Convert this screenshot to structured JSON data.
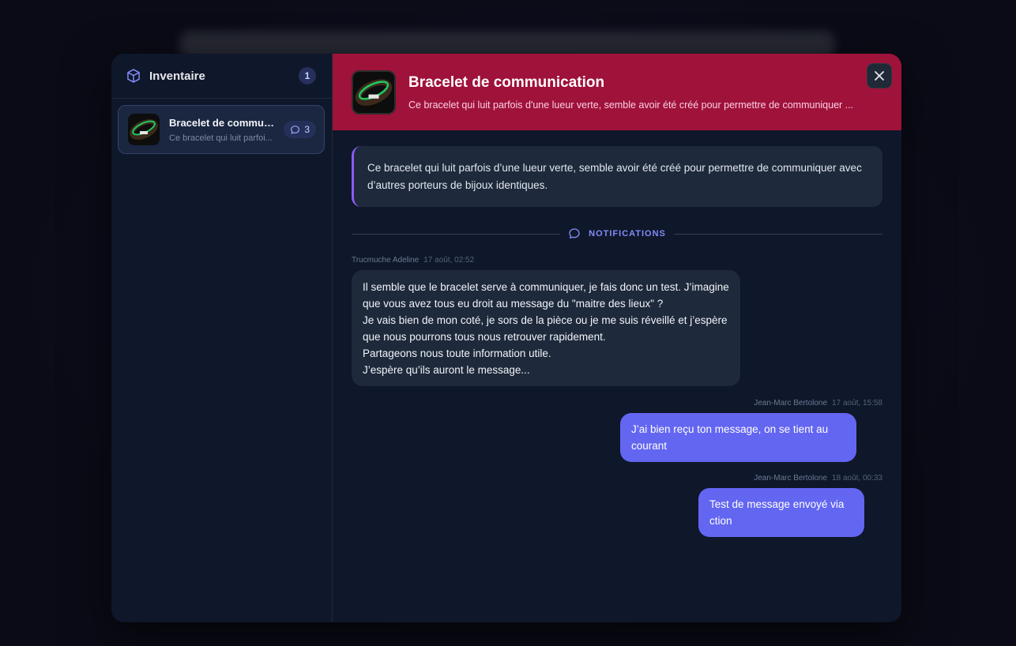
{
  "sidebar": {
    "title": "Inventaire",
    "count": "1",
    "items": [
      {
        "name": "Bracelet de commun...",
        "desc": "Ce bracelet qui luit parfoi...",
        "message_count": "3"
      }
    ]
  },
  "item": {
    "title": "Bracelet de communication",
    "subtitle": "Ce bracelet qui luit parfois d'une lueur verte, semble avoir été créé pour permettre de communiquer ...",
    "description": "Ce bracelet qui luit parfois d’une lueur verte, semble avoir été créé pour permettre de communiquer avec d’autres porteurs de bijoux identiques."
  },
  "notifications_label": "NOTIFICATIONS",
  "messages": [
    {
      "author": "Trucmuche Adeline",
      "time": "17 août, 02:52",
      "lines": [
        "Il semble que le bracelet serve à communiquer, je fais donc un test. J’imagine",
        "que vous avez tous eu droit au message du \"maitre des lieux\" ?",
        "Je vais bien de mon coté, je sors de la pièce ou je me suis réveillé et j’espère",
        "que nous pourrons tous nous retrouver rapidement.",
        "Partageons nous toute information utile.",
        "J’espère qu’ils auront le message..."
      ]
    },
    {
      "author": "Jean-Marc Bertolone",
      "time": "17 août, 15:58",
      "lines": [
        "J’ai bien reçu ton message, on se tient au",
        "courant"
      ]
    },
    {
      "author": "Jean-Marc Bertolone",
      "time": "18 août, 00:33",
      "lines": [
        "Test de message envoyé via",
        "ction"
      ]
    }
  ],
  "colors": {
    "header_bg": "#9f1239",
    "accent": "#6366f1",
    "quote_border": "#8b5cf6"
  },
  "icons": {
    "sidebar": "cube-icon",
    "messages": "chat-bubble-icon",
    "close": "close-icon"
  }
}
